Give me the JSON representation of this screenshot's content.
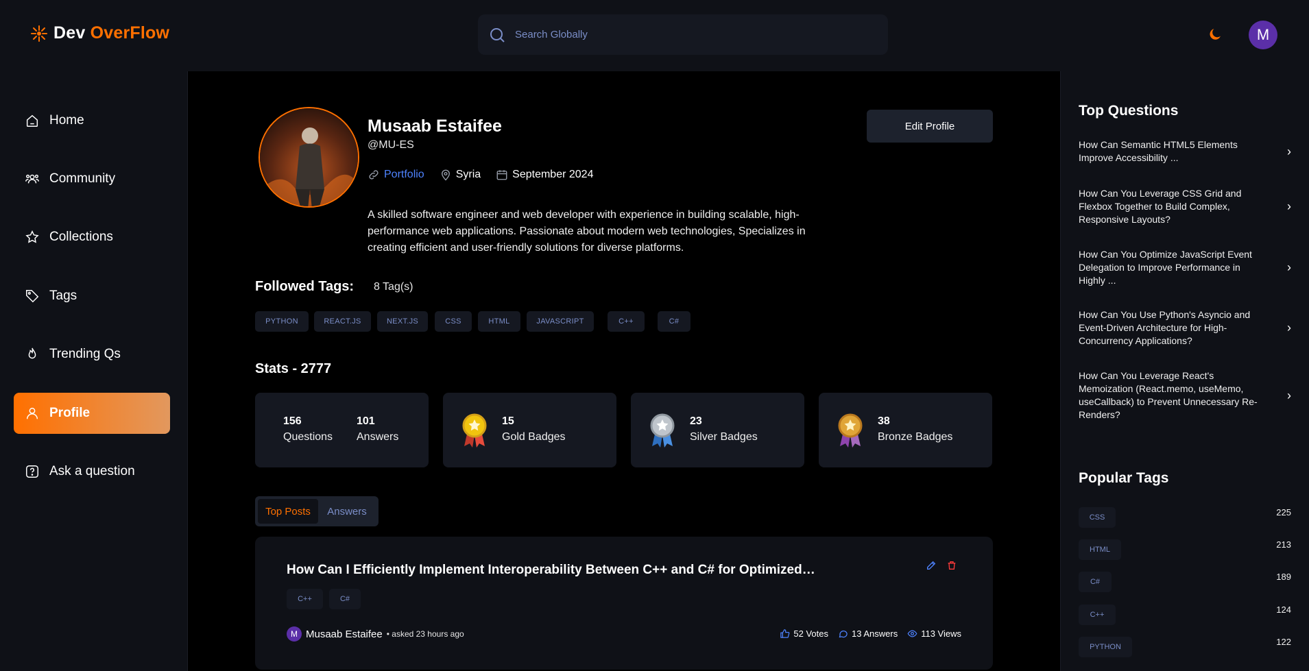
{
  "header": {
    "logo_part1": "Dev",
    "logo_part2": "OverFlow",
    "search_placeholder": "Search Globally",
    "avatar_letter": "M"
  },
  "sidebar": {
    "items": [
      {
        "label": "Home",
        "icon": "home-icon"
      },
      {
        "label": "Community",
        "icon": "users-icon"
      },
      {
        "label": "Collections",
        "icon": "star-icon"
      },
      {
        "label": "Tags",
        "icon": "tag-icon"
      },
      {
        "label": "Trending Qs",
        "icon": "flame-icon"
      },
      {
        "label": "Profile",
        "icon": "user-icon",
        "active": true
      },
      {
        "label": "Ask a question",
        "icon": "question-icon"
      }
    ]
  },
  "profile": {
    "name": "Musaab Estaifee",
    "handle": "@MU-ES",
    "portfolio": "Portfolio",
    "location": "Syria",
    "joined": "September 2024",
    "bio": "A skilled software engineer and web developer with experience in building scalable, high-performance web applications. Passionate about modern web technologies, Specializes in creating efficient and user-friendly solutions for diverse platforms.",
    "edit_label": "Edit Profile"
  },
  "followed": {
    "title": "Followed Tags:",
    "count": "8 Tag(s)",
    "tags": [
      "PYTHON",
      "REACT.JS",
      "NEXT.JS",
      "CSS",
      "HTML",
      "JAVASCRIPT",
      "C++",
      "C#"
    ]
  },
  "stats": {
    "title": "Stats - 2777",
    "questions": {
      "value": "156",
      "label": "Questions"
    },
    "answers": {
      "value": "101",
      "label": "Answers"
    },
    "gold": {
      "value": "15",
      "label": "Gold Badges"
    },
    "silver": {
      "value": "23",
      "label": "Silver Badges"
    },
    "bronze": {
      "value": "38",
      "label": "Bronze Badges"
    }
  },
  "tabs": {
    "top_posts": "Top Posts",
    "answers": "Answers"
  },
  "post": {
    "title": "How Can I Efficiently Implement Interoperability Between C++ and C# for Optimized…",
    "tags": [
      "C++",
      "C#"
    ],
    "author_initial": "M",
    "author": "Musaab Estaifee",
    "asked": "• asked 23 hours ago",
    "votes": "52 Votes",
    "answers": "13 Answers",
    "views": "113 Views"
  },
  "right": {
    "top_title": "Top Questions",
    "questions": [
      "How Can Semantic HTML5 Elements Improve Accessibility ...",
      "How Can You Leverage CSS Grid and Flexbox Together to Build Complex, Responsive Layouts?",
      "How Can You Optimize JavaScript Event Delegation to Improve Performance in Highly ...",
      "How Can You Use Python's Asyncio and Event-Driven Architecture for High-Concurrency Applications?",
      "How Can You Leverage React's Memoization (React.memo, useMemo, useCallback) to Prevent Unnecessary Re-Renders?"
    ],
    "popular_title": "Popular Tags",
    "popular": [
      {
        "name": "CSS",
        "count": "225"
      },
      {
        "name": "HTML",
        "count": "213"
      },
      {
        "name": "C#",
        "count": "189"
      },
      {
        "name": "C++",
        "count": "124"
      },
      {
        "name": "PYTHON",
        "count": "122"
      }
    ]
  },
  "colors": {
    "accent": "#ff7000",
    "link": "#4e83ff",
    "tag_text": "#7b8ec8",
    "card_bg": "#151821",
    "panel_bg": "#0f1117"
  }
}
